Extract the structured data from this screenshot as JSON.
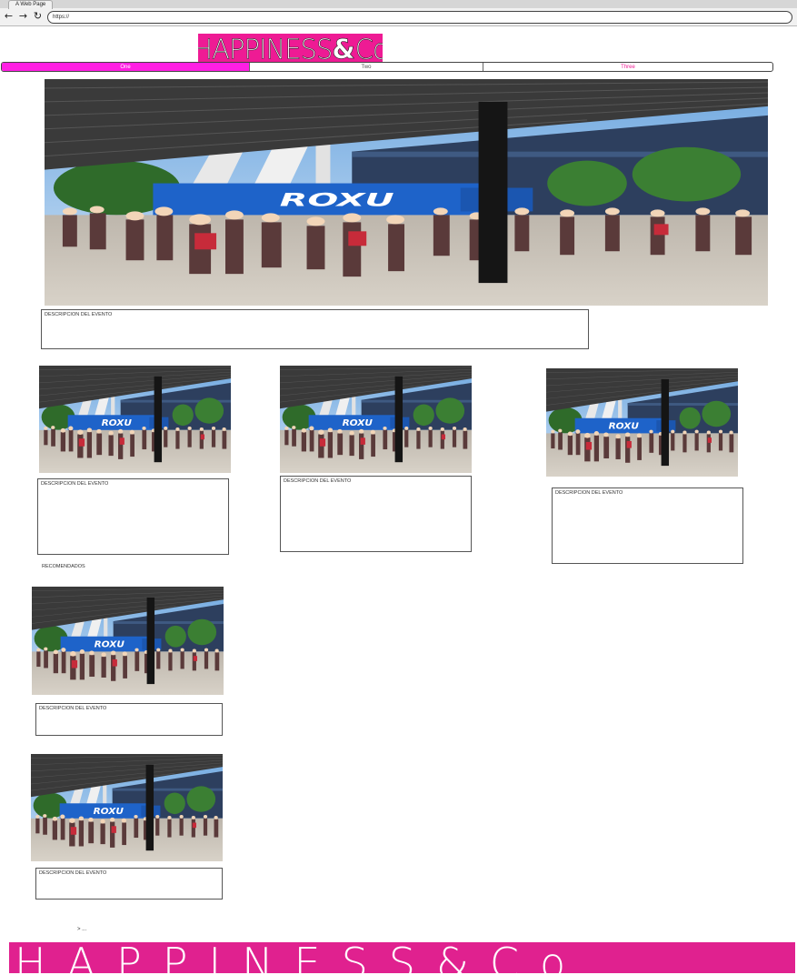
{
  "browser": {
    "tab_title": "A Web Page",
    "url": "https://",
    "back_icon": "arrow-left-icon",
    "forward_icon": "arrow-right-icon",
    "reload_icon": "reload-icon"
  },
  "logo": {
    "word": "HAPPINESS",
    "amp": "&",
    "suffix": "Co",
    "color": "#ee1b94"
  },
  "nav": {
    "tabs": [
      {
        "label": "One",
        "active": true
      },
      {
        "label": "Two",
        "active": false
      },
      {
        "label": "Three",
        "active": false
      }
    ],
    "active_color": "#ff1fe3"
  },
  "featured": {
    "description_label": "DESCRIPCION DEL EVENTO"
  },
  "events": [
    {
      "description_label": "DESCRIPCION DEL EVENTO"
    },
    {
      "description_label": "DESCRIPCION DEL EVENTO"
    },
    {
      "description_label": "DESCRIPCION DEL EVENTO"
    }
  ],
  "recommended": {
    "heading": "RECOMENDADOS",
    "items": [
      {
        "description_label": "DESCRIPCION DEL EVENTO"
      },
      {
        "description_label": "DESCRIPCION DEL EVENTO"
      }
    ]
  },
  "pager": {
    "label": "> ..."
  },
  "footer": {
    "word": "HAPPINESS&Co",
    "color": "#e0218f"
  },
  "image_alt": "event-photo-crowd-under-canopy"
}
